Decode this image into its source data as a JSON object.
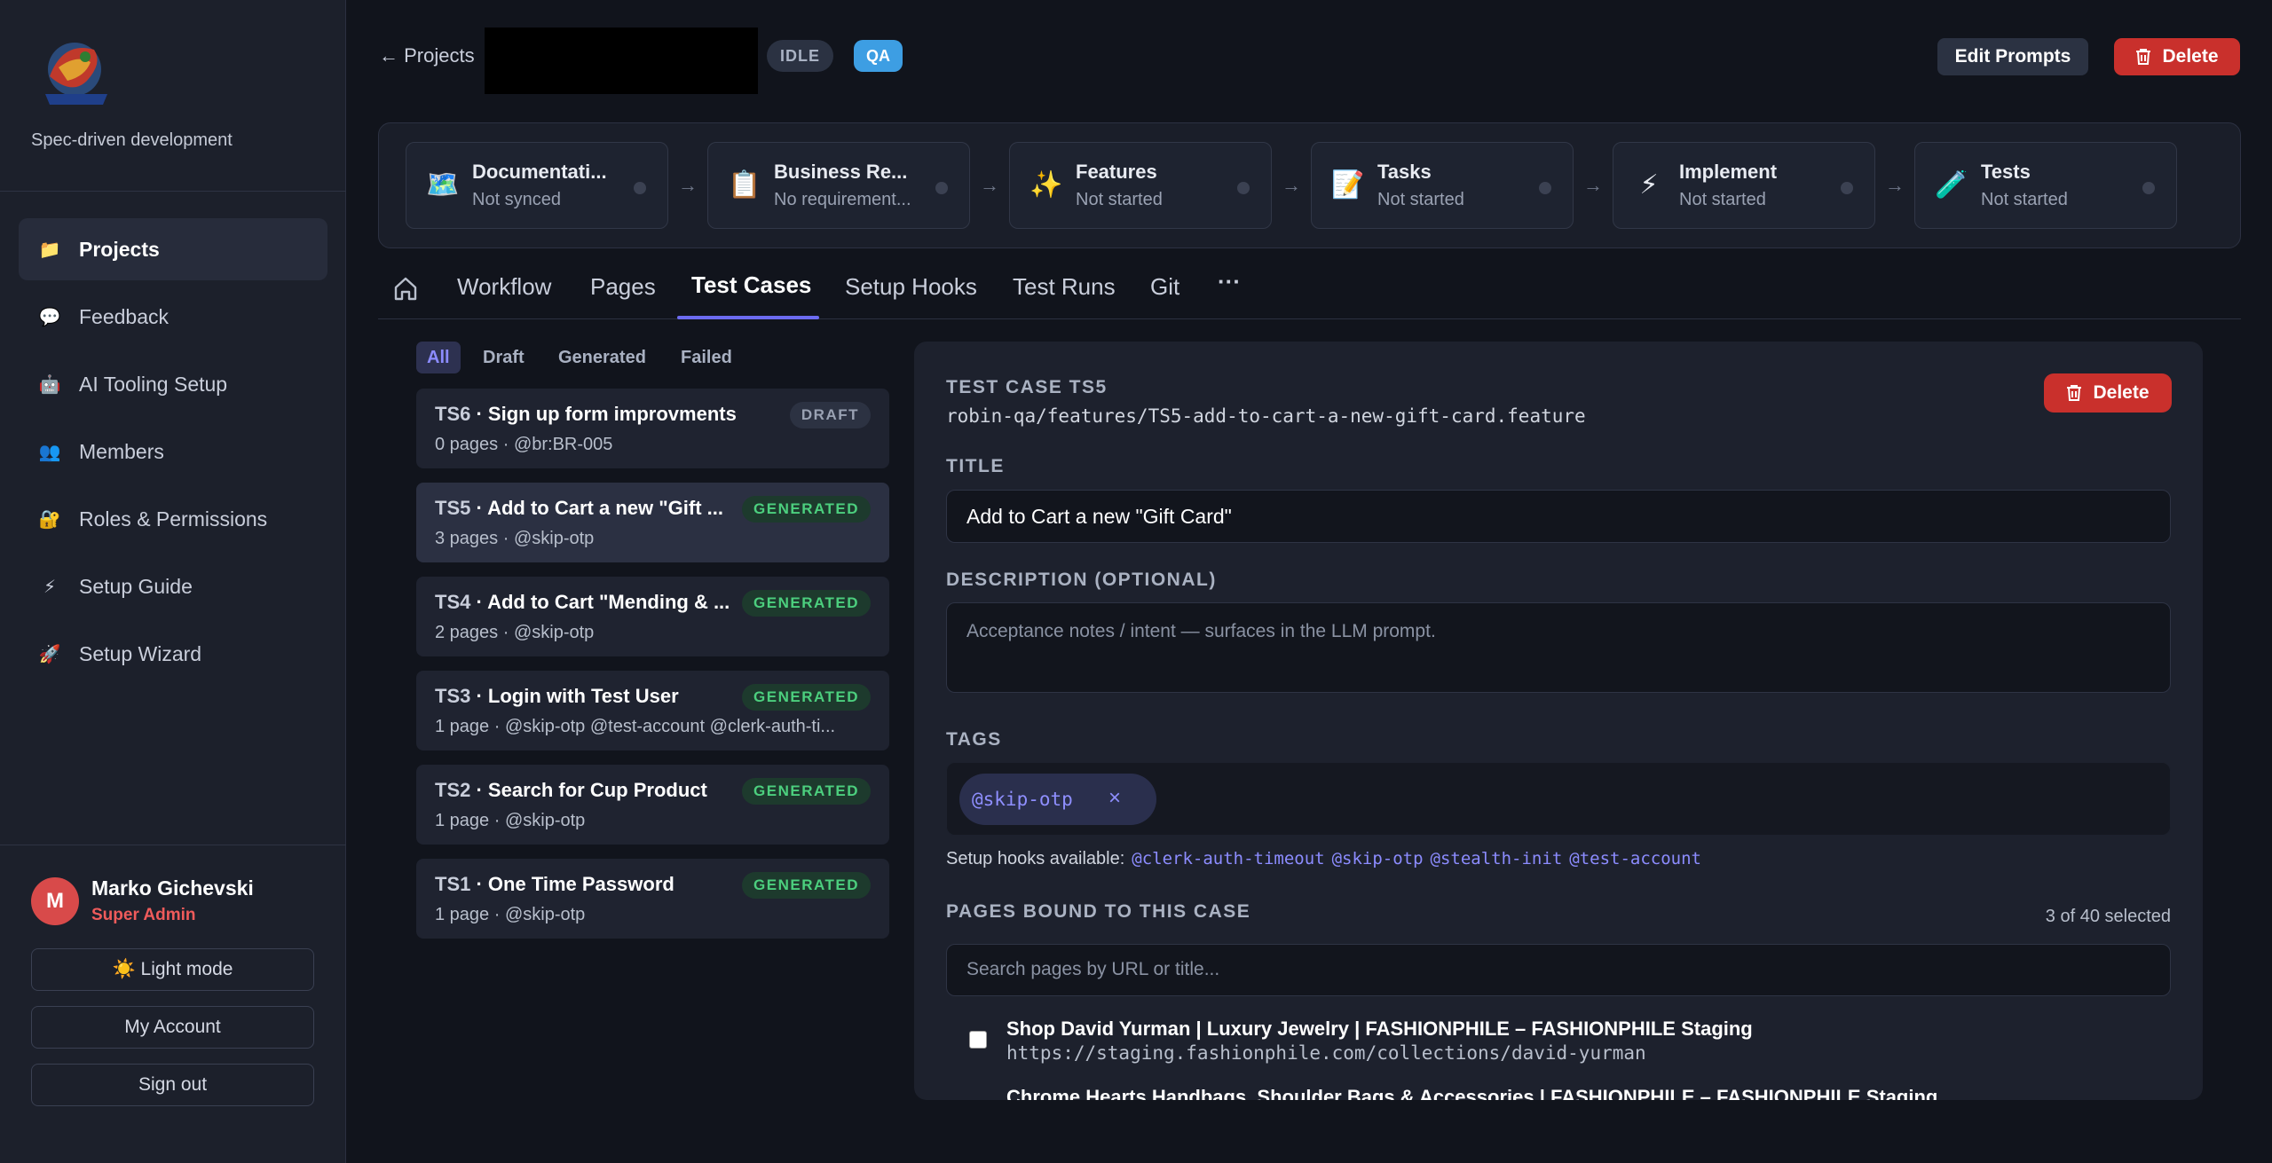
{
  "app": {
    "tagline": "Spec-driven development"
  },
  "sidebar": {
    "items": [
      {
        "label": "Projects",
        "icon": "📁",
        "icon_name": "folder-icon",
        "active": true
      },
      {
        "label": "Feedback",
        "icon": "💬",
        "icon_name": "speech-bubble-icon"
      },
      {
        "label": "AI Tooling Setup",
        "icon": "🤖",
        "icon_name": "robot-icon"
      },
      {
        "label": "Members",
        "icon": "👥",
        "icon_name": "people-icon"
      },
      {
        "label": "Roles & Permissions",
        "icon": "🔐",
        "icon_name": "lock-key-icon"
      },
      {
        "label": "Setup Guide",
        "icon": "⚡",
        "icon_name": "lightning-icon"
      },
      {
        "label": "Setup Wizard",
        "icon": "🚀",
        "icon_name": "rocket-icon"
      }
    ],
    "user": {
      "initial": "M",
      "name": "Marko Gichevski",
      "role": "Super Admin"
    },
    "light_mode_label": "☀️ Light mode",
    "my_account_label": "My Account",
    "sign_out_label": "Sign out"
  },
  "header": {
    "back_label": "← Projects",
    "status_badge": "IDLE",
    "env_badge": "QA",
    "edit_prompts_label": "Edit Prompts",
    "delete_label": "Delete"
  },
  "pipeline": [
    {
      "icon": "🗺️",
      "icon_name": "map-icon",
      "title": "Documentati...",
      "status": "Not synced"
    },
    {
      "icon": "📋",
      "icon_name": "clipboard-icon",
      "title": "Business Re...",
      "status": "No requirement..."
    },
    {
      "icon": "✨",
      "icon_name": "sparkles-icon",
      "title": "Features",
      "status": "Not started"
    },
    {
      "icon": "📝",
      "icon_name": "memo-icon",
      "title": "Tasks",
      "status": "Not started"
    },
    {
      "icon": "⚡",
      "icon_name": "lightning-icon",
      "title": "Implement",
      "status": "Not started"
    },
    {
      "icon": "🧪",
      "icon_name": "test-tube-icon",
      "title": "Tests",
      "status": "Not started"
    }
  ],
  "pipeline_arrow": "→",
  "tabs": [
    {
      "label": "Workflow"
    },
    {
      "label": "Pages"
    },
    {
      "label": "Test Cases",
      "active": true
    },
    {
      "label": "Setup Hooks"
    },
    {
      "label": "Test Runs"
    },
    {
      "label": "Git"
    }
  ],
  "more_label": "···",
  "filters": [
    "All",
    "Draft",
    "Generated",
    "Failed"
  ],
  "cases": [
    {
      "id": "TS6",
      "title": "Sign up form improvments",
      "meta": "0 pages · @br:BR-005",
      "status": "DRAFT"
    },
    {
      "id": "TS5",
      "title": "Add to Cart a new \"Gift ...",
      "meta": "3 pages · @skip-otp",
      "status": "GENERATED",
      "selected": true
    },
    {
      "id": "TS4",
      "title": "Add to Cart \"Mending & ...",
      "meta": "2 pages · @skip-otp",
      "status": "GENERATED"
    },
    {
      "id": "TS3",
      "title": "Login with Test User",
      "meta": "1 page · @skip-otp @test-account @clerk-auth-ti...",
      "status": "GENERATED"
    },
    {
      "id": "TS2",
      "title": "Search for Cup Product",
      "meta": "1 page · @skip-otp",
      "status": "GENERATED"
    },
    {
      "id": "TS1",
      "title": "One Time Password",
      "meta": "1 page · @skip-otp",
      "status": "GENERATED"
    }
  ],
  "detail": {
    "heading": "TEST CASE TS5",
    "path": "robin-qa/features/TS5-add-to-cart-a-new-gift-card.feature",
    "delete_label": "Delete",
    "title_label": "TITLE",
    "title_value": "Add to Cart a new \"Gift Card\"",
    "description_label": "DESCRIPTION (OPTIONAL)",
    "description_placeholder": "Acceptance notes / intent — surfaces in the LLM prompt.",
    "tags_label": "TAGS",
    "tags": [
      "@skip-otp"
    ],
    "tag_remove": "×",
    "hooks_prefix": "Setup hooks available:",
    "hooks": [
      "@clerk-auth-timeout",
      "@skip-otp",
      "@stealth-init",
      "@test-account"
    ],
    "pages_label": "PAGES BOUND TO THIS CASE",
    "selected_count": "3 of 40 selected",
    "search_placeholder": "Search pages by URL or title...",
    "pages": [
      {
        "title": "Shop David Yurman | Luxury Jewelry | FASHIONPHILE – FASHIONPHILE Staging",
        "url": "https://staging.fashionphile.com/collections/david-yurman"
      },
      {
        "title": "Chrome Hearts Handbags, Shoulder Bags & Accessories | FASHIONPHILE – FASHIONPHILE Staging",
        "url": ""
      }
    ]
  }
}
